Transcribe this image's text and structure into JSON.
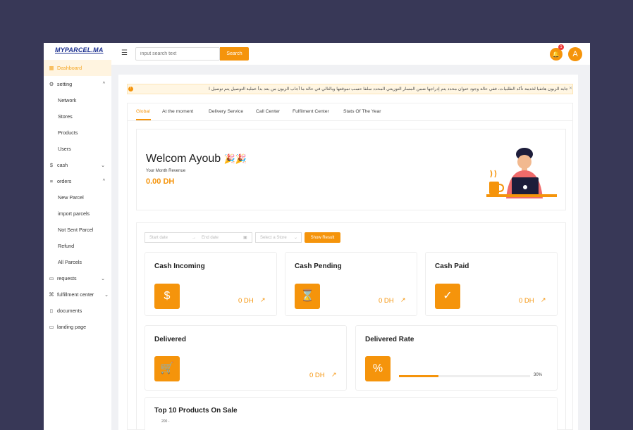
{
  "sidebar": {
    "logo": "MYPARCEL.MA",
    "items": [
      {
        "label": "Dashboard",
        "icon": "grid-icon"
      },
      {
        "label": "setting",
        "icon": "gear-icon"
      },
      {
        "label": "Network"
      },
      {
        "label": "Stores"
      },
      {
        "label": "Products"
      },
      {
        "label": "Users"
      },
      {
        "label": "cash",
        "icon": "dollar-icon"
      },
      {
        "label": "orders",
        "icon": "list-icon"
      },
      {
        "label": "New Parcel"
      },
      {
        "label": "import parcels"
      },
      {
        "label": "Not Sent Parcel"
      },
      {
        "label": "Refund"
      },
      {
        "label": "All Parcels"
      },
      {
        "label": "requests",
        "icon": "folder-icon"
      },
      {
        "label": "fulfillment center",
        "icon": "network-icon"
      },
      {
        "label": "documents",
        "icon": "document-icon"
      },
      {
        "label": "landing page",
        "icon": "monitor-icon"
      }
    ]
  },
  "header": {
    "search_placeholder": "input search text",
    "search_button": "Search",
    "notification_count": "1",
    "avatar_letter": "A"
  },
  "alert": {
    "text": "جابة الزبون هاتفيا لخدمة تأكد الطلبيات، ففي حالة وجود عنوان محدد يتم إدراجها ضمن المسار التوزيعي المحدد سلفا حسب تموقعها وبالتالي في حالة ما أجاب الزبون من بعد بدأ عملية التوصيل يتم توصيل ا"
  },
  "tabs": [
    "Global",
    "At the moment",
    "Delivery Service",
    "Call Center",
    "Fulfilment Center",
    "Stats Of The Year"
  ],
  "welcome": {
    "title": "Welcom Ayoub",
    "subtitle": "Your Month Revenue",
    "value": "0.00 DH"
  },
  "filters": {
    "start_placeholder": "Start date",
    "end_placeholder": "End date",
    "store_placeholder": "Select a Store",
    "show_button": "Show Result"
  },
  "cards": {
    "cash_incoming": {
      "title": "Cash Incoming",
      "value": "0 DH"
    },
    "cash_pending": {
      "title": "Cash Pending",
      "value": "0 DH"
    },
    "cash_paid": {
      "title": "Cash Paid",
      "value": "0 DH"
    },
    "delivered": {
      "title": "Delivered",
      "value": "0 DH"
    },
    "delivered_rate": {
      "title": "Delivered Rate",
      "percent_text": "30%",
      "percent": 30
    }
  },
  "top10": {
    "title": "Top 10 Products On Sale",
    "first_tick": "200 -"
  },
  "colors": {
    "accent": "#f5940b",
    "background": "#383857"
  }
}
